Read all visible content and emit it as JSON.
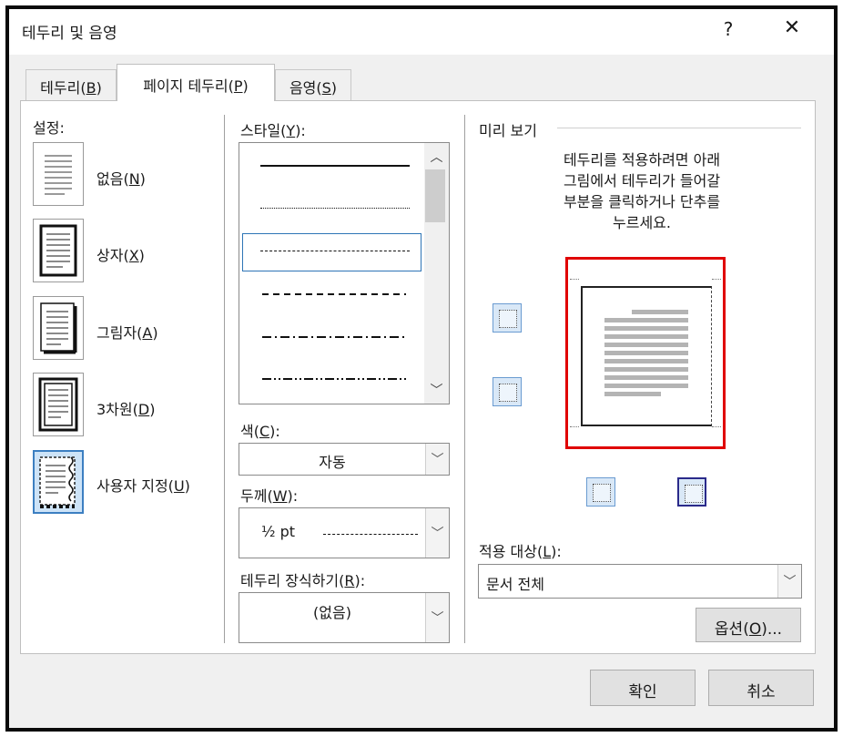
{
  "window": {
    "title": "테두리 및 음영",
    "help": "?",
    "close": "✕"
  },
  "tabs": [
    {
      "label": "테두리(",
      "key": "B",
      "end": ")"
    },
    {
      "label": "페이지 테두리(",
      "key": "P",
      "end": ")"
    },
    {
      "label": "음영(",
      "key": "S",
      "end": ")"
    }
  ],
  "settings": {
    "label": "설정:",
    "items": [
      {
        "label": "없음(",
        "key": "N",
        "end": ")"
      },
      {
        "label": "상자(",
        "key": "X",
        "end": ")"
      },
      {
        "label": "그림자(",
        "key": "A",
        "end": ")"
      },
      {
        "label": "3차원(",
        "key": "D",
        "end": ")"
      },
      {
        "label": "사용자 지정(",
        "key": "U",
        "end": ")"
      }
    ]
  },
  "style": {
    "label": "스타일(",
    "key": "Y",
    "end": "):"
  },
  "color": {
    "label": "색(",
    "key": "C",
    "end": "):",
    "value": "자동"
  },
  "width": {
    "label": "두께(",
    "key": "W",
    "end": "):",
    "value": "½ pt"
  },
  "art": {
    "label": "테두리 장식하기(",
    "key": "R",
    "end": "):",
    "value": "(없음)"
  },
  "preview": {
    "label": "미리 보기",
    "hint": [
      "테두리를 적용하려면 아래",
      "그림에서 테두리가 들어갈",
      "부분을 클릭하거나 단추를",
      "누르세요."
    ]
  },
  "apply": {
    "label": "적용 대상(",
    "key": "L",
    "end": "):",
    "value": "문서 전체"
  },
  "options_button": {
    "label": "옵션(",
    "key": "O",
    "end": ")..."
  },
  "ok_button": "확인",
  "cancel_button": "취소"
}
